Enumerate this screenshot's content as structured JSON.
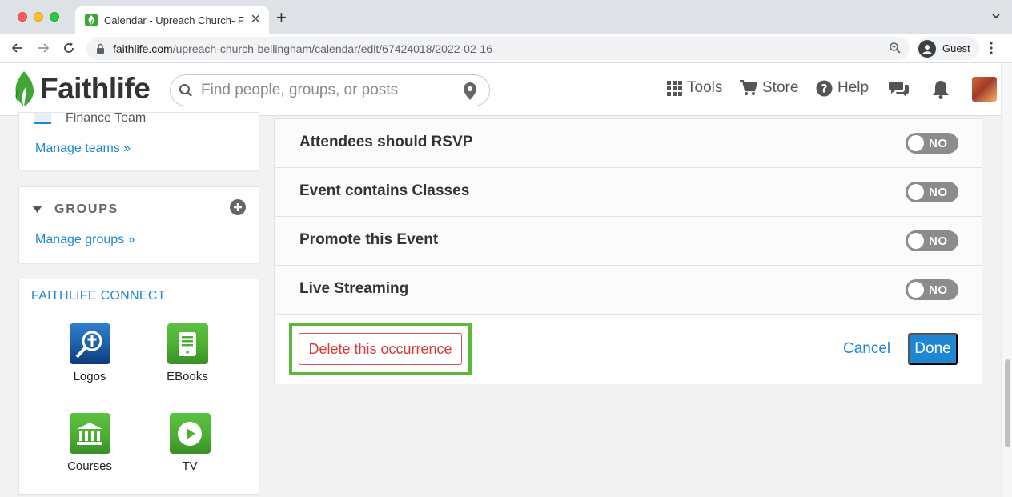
{
  "browser": {
    "tab_title": "Calendar - Upreach Church- Fa",
    "url_host": "faithlife.com",
    "url_path": "/upreach-church-bellingham/calendar/edit/67424018/2022-02-16",
    "profile_label": "Guest"
  },
  "header": {
    "logo_text": "Faithlife",
    "search_placeholder": "Find people, groups, or posts",
    "nav": {
      "tools": "Tools",
      "store": "Store",
      "help": "Help"
    }
  },
  "sidebar": {
    "teams": {
      "item_label": "Finance Team",
      "manage_link": "Manage teams »"
    },
    "groups": {
      "title": "GROUPS",
      "manage_link": "Manage groups »"
    },
    "connect": {
      "title": "FAITHLIFE CONNECT",
      "apps": [
        {
          "label": "Logos",
          "icon": "logos-icon",
          "color": "#1d5ea8"
        },
        {
          "label": "EBooks",
          "icon": "ebooks-icon",
          "color": "#4caf33"
        },
        {
          "label": "Courses",
          "icon": "courses-icon",
          "color": "#4caf33"
        },
        {
          "label": "TV",
          "icon": "tv-icon",
          "color": "#4caf33"
        }
      ]
    }
  },
  "settings": {
    "rows": [
      {
        "label": "Attendees should RSVP",
        "state": "NO"
      },
      {
        "label": "Event contains Classes",
        "state": "NO"
      },
      {
        "label": "Promote this Event",
        "state": "NO"
      },
      {
        "label": "Live Streaming",
        "state": "NO"
      }
    ],
    "delete_label": "Delete this occurrence",
    "cancel_label": "Cancel",
    "done_label": "Done"
  },
  "colors": {
    "accent": "#1e87d4",
    "brand_green": "#4caf33",
    "danger": "#d33b36",
    "highlight": "#5cb83a",
    "toggle_off": "#8c8c8c"
  }
}
